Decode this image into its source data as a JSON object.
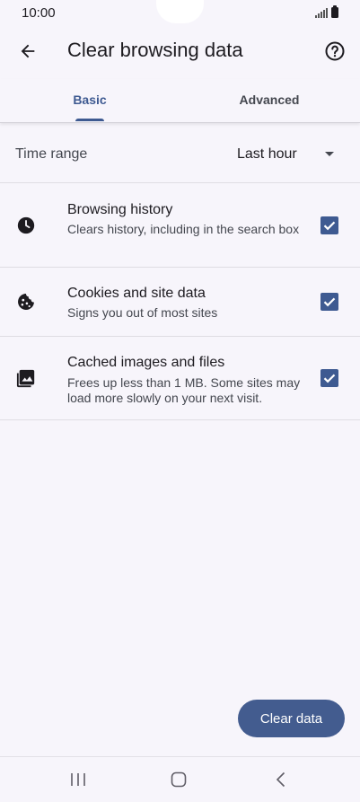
{
  "status_bar": {
    "time": "10:00",
    "icons": [
      "signal-icon",
      "battery-icon"
    ]
  },
  "header": {
    "title": "Clear browsing data",
    "back_icon": "arrow-left-icon",
    "help_icon": "help-circle-icon"
  },
  "tabs": [
    {
      "label": "Basic",
      "selected": true
    },
    {
      "label": "Advanced",
      "selected": false
    }
  ],
  "time_range": {
    "label": "Time range",
    "value": "Last hour"
  },
  "options": [
    {
      "title": "Browsing history",
      "description": "Clears history, including in the search box",
      "icon": "clock-icon",
      "checked": true
    },
    {
      "title": "Cookies and site data",
      "description": "Signs you out of most sites",
      "icon": "cookie-icon",
      "checked": true
    },
    {
      "title": "Cached images and files",
      "description": "Frees up less than 1 MB. Some sites may load more slowly on your next visit.",
      "icon": "image-icon",
      "checked": true
    }
  ],
  "actions": {
    "clear_label": "Clear data"
  },
  "nav_bar": {
    "icons": [
      "recents-icon",
      "home-icon",
      "back-icon"
    ]
  },
  "colors": {
    "accent": "#3e5a91",
    "button": "#435c8f",
    "background": "#f7f5fb"
  }
}
